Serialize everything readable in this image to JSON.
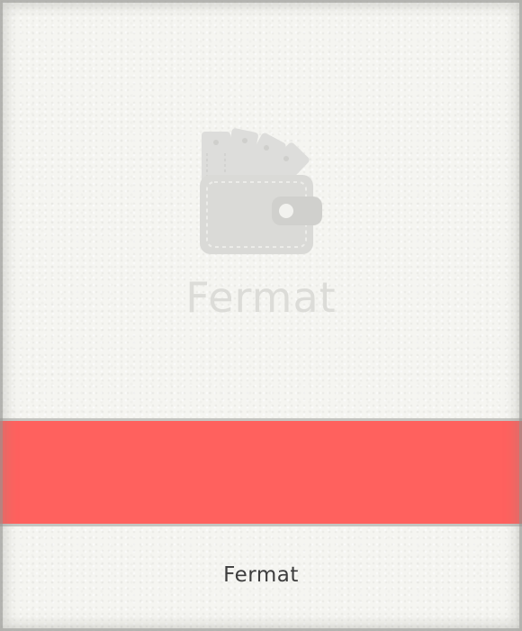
{
  "logo": {
    "icon": "wallet-icon",
    "text": "Fermat"
  },
  "band": {
    "color": "#ff615e"
  },
  "footer": {
    "title": "Fermat"
  }
}
